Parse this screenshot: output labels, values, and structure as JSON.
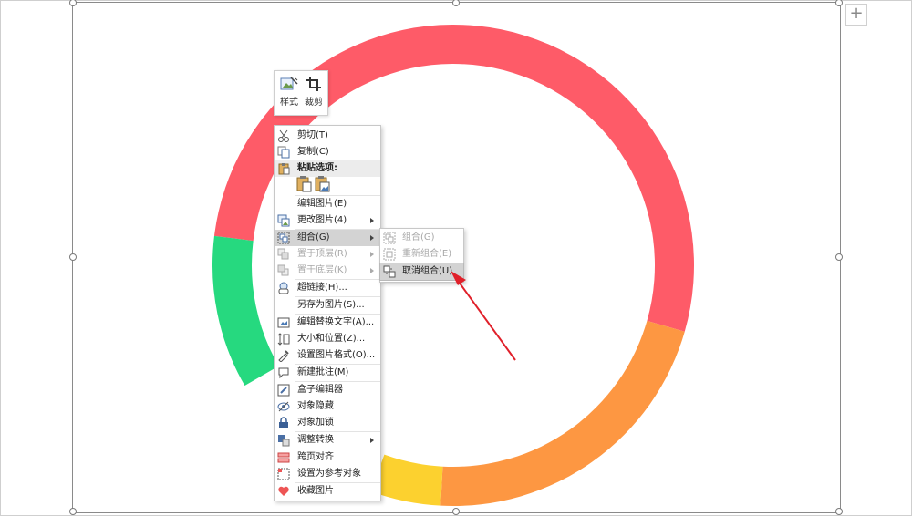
{
  "colors": {
    "red": "#fe5b68",
    "orange": "#fd9742",
    "yellow": "#fcd12f",
    "green": "#26d97f",
    "arrow": "#e0202a"
  },
  "mini_toolbar": {
    "style_label": "样式",
    "crop_label": "裁剪",
    "style_icon": "picture-style-icon",
    "crop_icon": "crop-icon"
  },
  "context_menu": {
    "cut": "剪切(T)",
    "copy": "复制(C)",
    "paste_options": "粘贴选项:",
    "paste_icons": [
      "paste-keep-icon",
      "paste-picture-icon"
    ],
    "edit_picture": "编辑图片(E)",
    "change_picture": "更改图片(4)",
    "group": "组合(G)",
    "bring_front": "置于顶层(R)",
    "send_back": "置于底层(K)",
    "hyperlink": "超链接(H)...",
    "save_as_picture": "另存为图片(S)...",
    "edit_alt_text": "编辑替换文字(A)...",
    "size_position": "大小和位置(Z)...",
    "format_picture": "设置图片格式(O)...",
    "new_comment": "新建批注(M)",
    "box_editor": "盒子编辑器",
    "hide_object": "对象隐藏",
    "lock_object": "对象加锁",
    "adjust_convert": "调整转换",
    "cross_page_align": "跨页对齐",
    "set_reference": "设置为参考对象",
    "favorite_picture": "收藏图片"
  },
  "group_submenu": {
    "group": "组合(G)",
    "regroup": "重新组合(E)",
    "ungroup": "取消组合(U)"
  }
}
